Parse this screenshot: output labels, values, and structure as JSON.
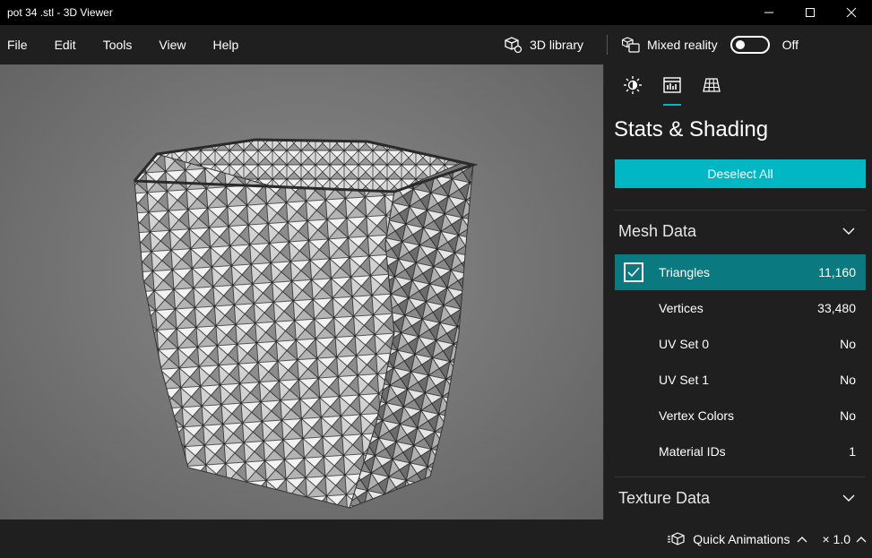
{
  "window": {
    "title": "pot 34 .stl - 3D Viewer",
    "minimize_icon": "minimize-icon",
    "maximize_icon": "maximize-icon",
    "close_icon": "close-icon"
  },
  "menu": {
    "items": [
      "File",
      "Edit",
      "Tools",
      "View",
      "Help"
    ]
  },
  "toolbar": {
    "library_label": "3D library",
    "mixed_reality_label": "Mixed reality",
    "mixed_reality_state": "Off"
  },
  "panel": {
    "tabs": [
      {
        "icon": "lighting-icon",
        "active": false
      },
      {
        "icon": "stats-icon",
        "active": true
      },
      {
        "icon": "grid-icon",
        "active": false
      }
    ],
    "title": "Stats & Shading",
    "deselect_label": "Deselect All",
    "mesh_section": "Mesh Data",
    "rows": [
      {
        "label": "Triangles",
        "value": "11,160",
        "checked": true
      },
      {
        "label": "Vertices",
        "value": "33,480"
      },
      {
        "label": "UV Set 0",
        "value": "No"
      },
      {
        "label": "UV Set 1",
        "value": "No"
      },
      {
        "label": "Vertex Colors",
        "value": "No"
      },
      {
        "label": "Material IDs",
        "value": "1"
      }
    ],
    "texture_section": "Texture Data"
  },
  "bottom": {
    "quick_animations_label": "Quick Animations",
    "speed_label": "× 1.0"
  },
  "colors": {
    "accent": "#00b7c3",
    "selected_row": "#0b7a80",
    "background": "#1f1f1f"
  }
}
